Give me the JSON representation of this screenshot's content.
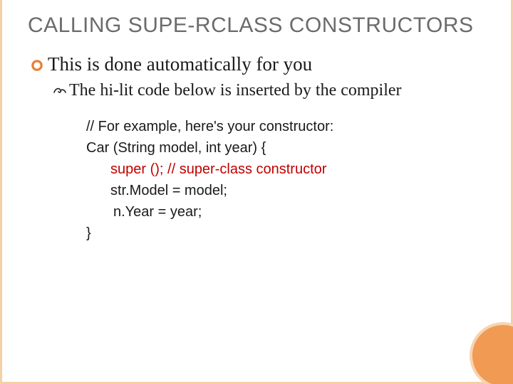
{
  "title": "CALLING SUPE-RCLASS CONSTRUCTORS",
  "bullet1": "This is done automatically for you",
  "bullet2": "The hi-lit code below is inserted by the compiler",
  "code": {
    "l1": "// For example, here's your constructor:",
    "l2": "Car (String model, int year)  {",
    "l3": "super ();  // super-class constructor",
    "l4": "str.Model = model;",
    "l5": " n.Year = year;",
    "l6": "}"
  }
}
